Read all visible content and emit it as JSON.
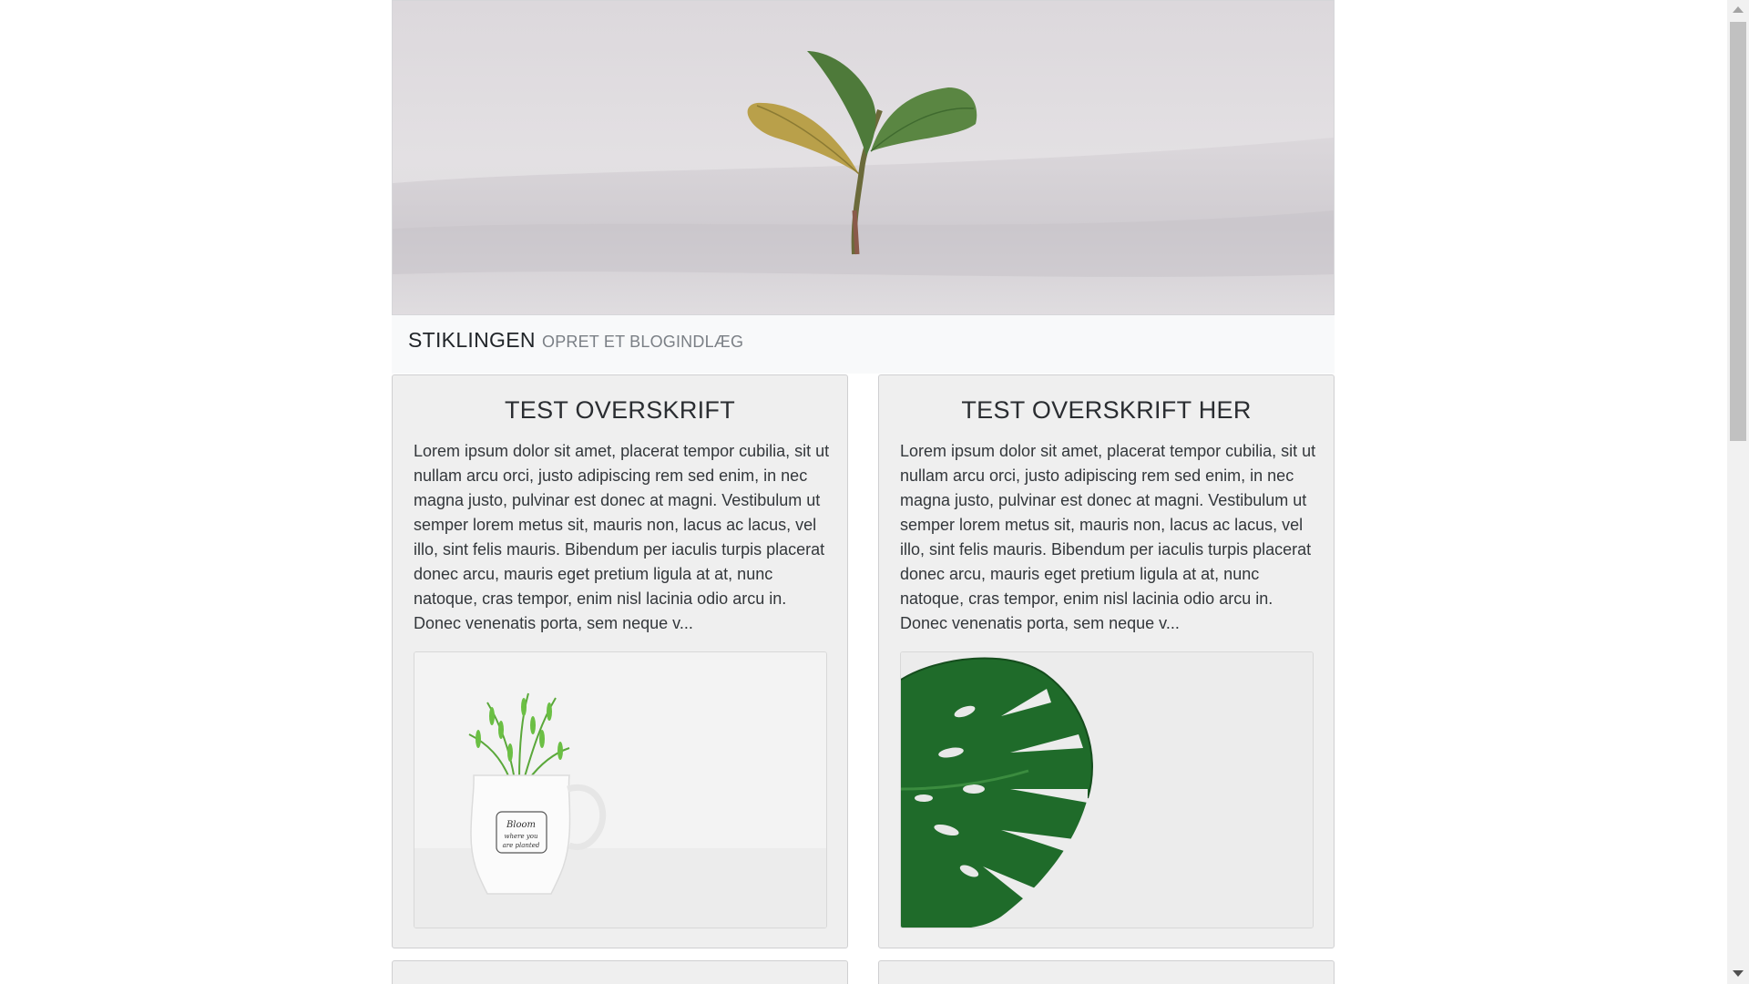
{
  "navbar": {
    "brand": "STIKLINGEN",
    "links": [
      {
        "label": "OPRET ET BLOGINDLÆG"
      }
    ]
  },
  "hero": {
    "image": "seedling-in-sand-image"
  },
  "posts": [
    {
      "title": "TEST OVERSKRIFT",
      "excerpt": "Lorem ipsum dolor sit amet, placerat tempor cubilia, sit ut nullam arcu orci, justo adipiscing rem sed enim, in nec magna justo, pulvinar est donec at magni. Vestibulum ut semper lorem metus sit, mauris non, lacus ac lacus, vel illo, sint felis mauris. Bibendum per iaculis turpis placerat donec arcu, mauris eget pretium ligula at at, nunc natoque, cras tempor, enim nisl lacinia odio arcu in. Donec venenatis porta, sem neque v...",
      "image": "rosemary-pitcher-image",
      "image_text": [
        "Bloom",
        "where you",
        "are planted"
      ]
    },
    {
      "title": "TEST OVERSKRIFT HER",
      "excerpt": "Lorem ipsum dolor sit amet, placerat tempor cubilia, sit ut nullam arcu orci, justo adipiscing rem sed enim, in nec magna justo, pulvinar est donec at magni. Vestibulum ut semper lorem metus sit, mauris non, lacus ac lacus, vel illo, sint felis mauris. Bibendum per iaculis turpis placerat donec arcu, mauris eget pretium ligula at at, nunc natoque, cras tempor, enim nisl lacinia odio arcu in. Donec venenatis porta, sem neque v...",
      "image": "monstera-leaf-image"
    }
  ],
  "colors": {
    "navbar_bg": "#f8f9fa",
    "card_bg": "#efefef",
    "nav_link": "#7a7f85"
  }
}
